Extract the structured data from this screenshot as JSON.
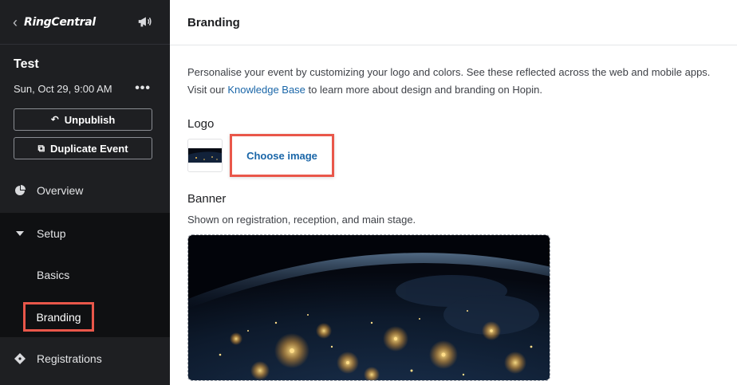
{
  "sidebar": {
    "back_icon": "chevron-left-icon",
    "logo_text": "RingCentral",
    "megaphone_icon": "megaphone-icon",
    "event": {
      "title": "Test",
      "date": "Sun, Oct 29, 9:00 AM",
      "more_icon": "•••"
    },
    "buttons": {
      "unpublish": {
        "label": "Unpublish",
        "icon": "undo-icon"
      },
      "duplicate": {
        "label": "Duplicate Event",
        "icon": "copy-icon"
      }
    },
    "nav": {
      "overview": {
        "label": "Overview",
        "icon": "pie-chart-icon"
      },
      "setup": {
        "label": "Setup",
        "icon": "caret-down-icon"
      },
      "basics": {
        "label": "Basics"
      },
      "branding": {
        "label": "Branding"
      },
      "registrations": {
        "label": "Registrations",
        "icon": "ticket-icon"
      }
    }
  },
  "main": {
    "title": "Branding",
    "intro_line1": "Personalise your event by customizing your logo and colors. See these reflected across the web and mobile apps.",
    "intro_line2_prefix": "Visit our ",
    "intro_link": "Knowledge Base",
    "intro_line2_suffix": " to learn more about design and branding on Hopin.",
    "logo_label": "Logo",
    "choose_image": "Choose image",
    "banner_label": "Banner",
    "banner_desc": "Shown on registration, reception, and main stage."
  },
  "colors": {
    "sidebar_bg": "#1e1f22",
    "setup_group_bg": "#0f1012",
    "highlight": "#e9574a",
    "link": "#1a66a8"
  }
}
